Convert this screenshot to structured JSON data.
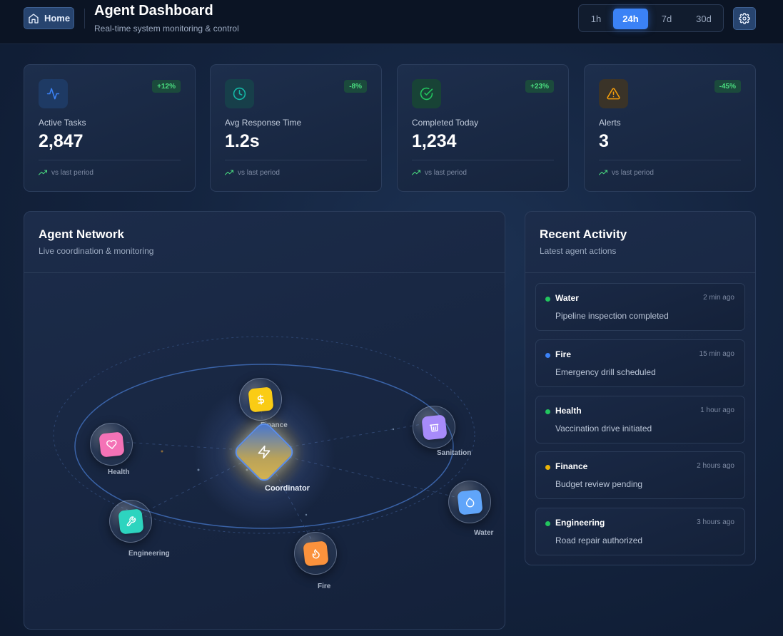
{
  "header": {
    "home_label": "Home",
    "title": "Agent Dashboard",
    "subtitle": "Real-time system monitoring & control",
    "ranges": [
      "1h",
      "24h",
      "7d",
      "30d"
    ],
    "active_range": "24h"
  },
  "stats": [
    {
      "label": "Active Tasks",
      "value": "2,847",
      "change": "+12%",
      "footnote": "vs last period",
      "icon": "activity-icon",
      "accent": "#3b82f6"
    },
    {
      "label": "Avg Response Time",
      "value": "1.2s",
      "change": "-8%",
      "footnote": "vs last period",
      "icon": "clock-icon",
      "accent": "#14b8a6"
    },
    {
      "label": "Completed Today",
      "value": "1,234",
      "change": "+23%",
      "footnote": "vs last period",
      "icon": "check-circle-icon",
      "accent": "#22c55e"
    },
    {
      "label": "Alerts",
      "value": "3",
      "change": "-45%",
      "footnote": "vs last period",
      "icon": "alert-triangle-icon",
      "accent": "#f59e0b"
    }
  ],
  "network": {
    "title": "Agent Network",
    "subtitle": "Live coordination & monitoring",
    "coordinator_label": "Coordinator",
    "agents": [
      {
        "name": "Finance",
        "icon": "dollar-icon",
        "color": "#facc15"
      },
      {
        "name": "Sanitation",
        "icon": "trash-icon",
        "color": "#a78bfa"
      },
      {
        "name": "Health",
        "icon": "heart-icon",
        "color": "#f472b6"
      },
      {
        "name": "Water",
        "icon": "droplet-icon",
        "color": "#60a5fa"
      },
      {
        "name": "Engineering",
        "icon": "wrench-icon",
        "color": "#2dd4bf"
      },
      {
        "name": "Fire",
        "icon": "flame-icon",
        "color": "#fb923c"
      }
    ]
  },
  "activity": {
    "title": "Recent Activity",
    "subtitle": "Latest agent actions",
    "items": [
      {
        "agent": "Water",
        "time": "2 min ago",
        "desc": "Pipeline inspection completed",
        "dot": "#22c55e"
      },
      {
        "agent": "Fire",
        "time": "15 min ago",
        "desc": "Emergency drill scheduled",
        "dot": "#3b82f6"
      },
      {
        "agent": "Health",
        "time": "1 hour ago",
        "desc": "Vaccination drive initiated",
        "dot": "#22c55e"
      },
      {
        "agent": "Finance",
        "time": "2 hours ago",
        "desc": "Budget review pending",
        "dot": "#eab308"
      },
      {
        "agent": "Engineering",
        "time": "3 hours ago",
        "desc": "Road repair authorized",
        "dot": "#22c55e"
      }
    ]
  }
}
